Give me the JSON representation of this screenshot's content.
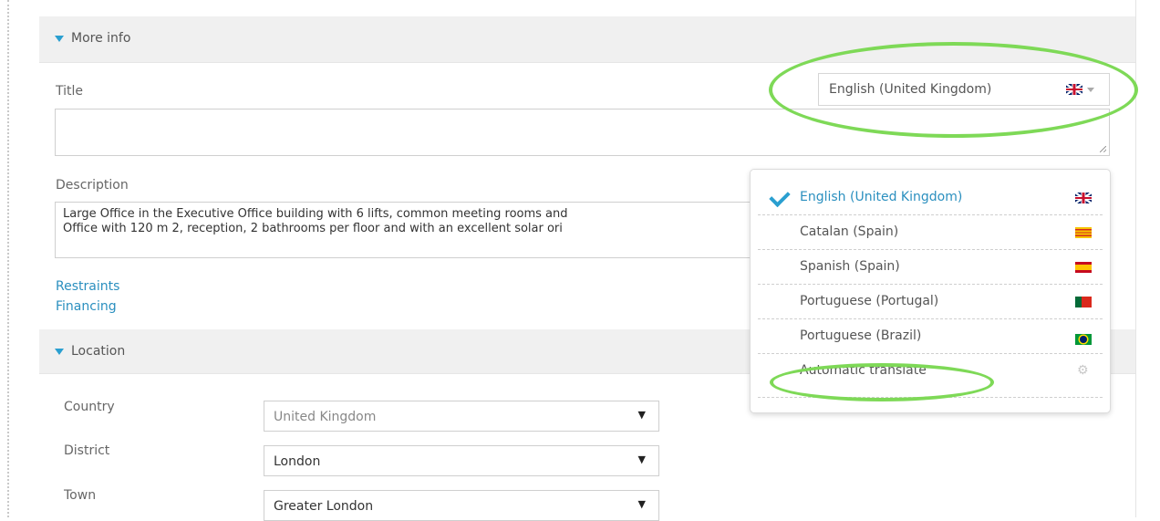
{
  "more_info": {
    "section_title": "More info",
    "title_label": "Title",
    "title_value": "",
    "description_label": "Description",
    "description_value": "Large Office in the Executive Office building with 6 lifts, common meeting rooms and\nOffice with 120 m 2, reception, 2 bathrooms per floor and with an excellent solar ori",
    "links": [
      "Restraints",
      "Financing"
    ]
  },
  "language_selector": {
    "selected": "English (United Kingdom)",
    "selected_flag": "uk-flag-icon",
    "options": [
      {
        "label": "English (United Kingdom)",
        "icon": "uk-flag-icon",
        "selected": true
      },
      {
        "label": "Catalan (Spain)",
        "icon": "catalan-flag-icon",
        "selected": false
      },
      {
        "label": "Spanish (Spain)",
        "icon": "spain-flag-icon",
        "selected": false
      },
      {
        "label": "Portuguese (Portugal)",
        "icon": "portugal-flag-icon",
        "selected": false
      },
      {
        "label": "Portuguese (Brazil)",
        "icon": "brazil-flag-icon",
        "selected": false
      },
      {
        "label": "Automatic translate",
        "icon": "gear-icon",
        "selected": false
      }
    ]
  },
  "location": {
    "section_title": "Location",
    "country_label": "Country",
    "country_value": "United Kingdom",
    "district_label": "District",
    "district_value": "London",
    "town_label": "Town",
    "town_value": "Greater London"
  },
  "colors": {
    "accent": "#2a9fd0",
    "link": "#2a8fbf",
    "highlight": "#7ed957",
    "section_bg": "#f0f0f0"
  }
}
